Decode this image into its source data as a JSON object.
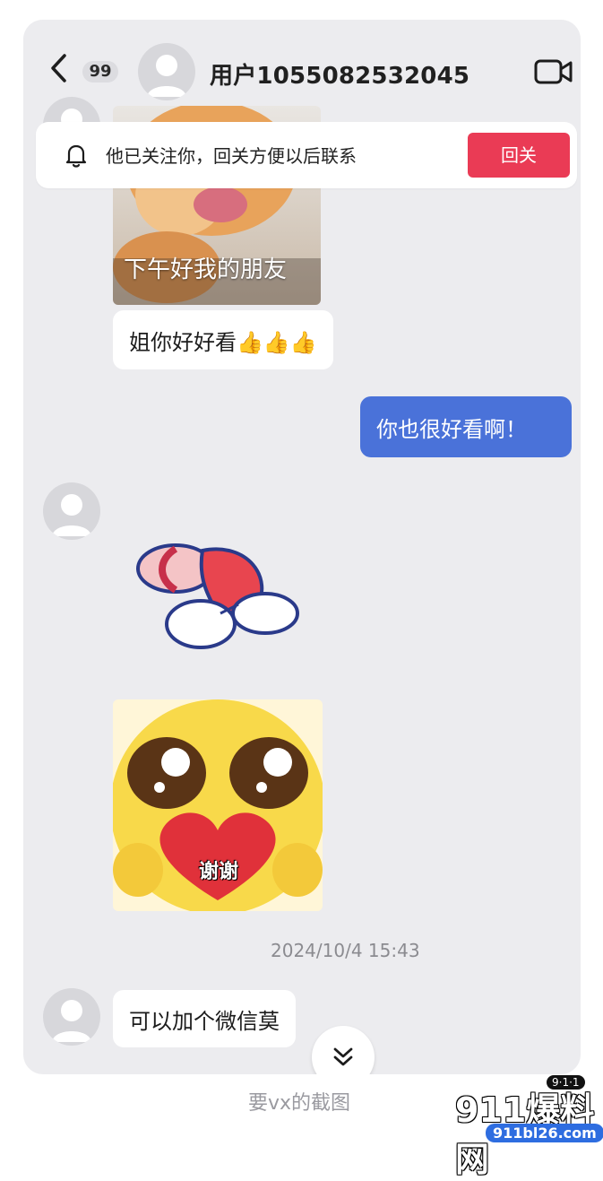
{
  "header": {
    "unread_count": "99",
    "username": "用户1055082532045"
  },
  "banner": {
    "text": "他已关注你，回关方便以后联系",
    "follow_label": "回关"
  },
  "messages": {
    "image_caption": "下午好我的朋友",
    "msg1": "姐你好好看👍👍👍",
    "reply": "你也很好看啊！",
    "sticker_text": "谢谢",
    "timestamp": "2024/10/4 15:43",
    "msg2": "可以加个微信莫"
  },
  "caption": "要vx的截图",
  "watermark": {
    "main": "911爆料网",
    "url": "911bl26.com",
    "top": "9·1·1"
  },
  "colors": {
    "background": "#ececef",
    "follow_button": "#ea3b55",
    "sent_bubble": "#4a72d9"
  },
  "icons": {
    "back": "chevron-left-icon",
    "video": "video-call-icon",
    "bell": "bell-icon",
    "scroll": "double-chevron-down-icon"
  }
}
